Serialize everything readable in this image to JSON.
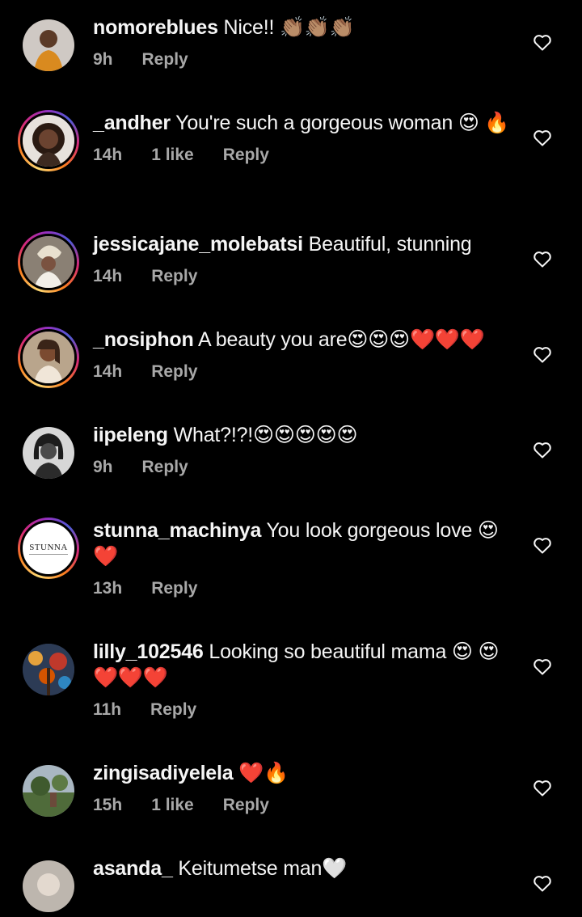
{
  "comments": [
    {
      "username": "nomoreblues",
      "text": " Nice!! 👏🏽👏🏽👏🏽",
      "time": "9h",
      "likes": "",
      "reply": "Reply",
      "avatar": "photo-avatar",
      "ring": false
    },
    {
      "username": "_andher",
      "text": " You're such a gorgeous woman 😍 🔥",
      "time": "14h",
      "likes": "1 like",
      "reply": "Reply",
      "avatar": "photo-avatar",
      "ring": true
    },
    {
      "username": "jessicajane_molebatsi",
      "text": " Beautiful, stunning",
      "time": "14h",
      "likes": "",
      "reply": "Reply",
      "avatar": "photo-avatar",
      "ring": true
    },
    {
      "username": "_nosiphon",
      "text": " A beauty you are😍😍😍❤️❤️❤️",
      "time": "14h",
      "likes": "",
      "reply": "Reply",
      "avatar": "photo-avatar",
      "ring": true
    },
    {
      "username": "iipeleng",
      "text": " What?!?!😍😍😍😍😍",
      "time": "9h",
      "likes": "",
      "reply": "Reply",
      "avatar": "photo-avatar",
      "ring": false
    },
    {
      "username": "stunna_machinya",
      "text": " You look gorgeous love 😍❤️",
      "time": "13h",
      "likes": "",
      "reply": "Reply",
      "avatar": "logo-avatar",
      "logo_text": "STUNNA",
      "ring": true
    },
    {
      "username": "lilly_102546",
      "text": " Looking so beautiful mama 😍 😍❤️❤️❤️",
      "time": "11h",
      "likes": "",
      "reply": "Reply",
      "avatar": "photo-avatar",
      "ring": false
    },
    {
      "username": "zingisadiyelela",
      "text": " ❤️🔥",
      "time": "15h",
      "likes": "1 like",
      "reply": "Reply",
      "avatar": "photo-avatar",
      "ring": false
    },
    {
      "username": "asanda_",
      "text": " Keitumetse man🤍",
      "time": "",
      "likes": "",
      "reply": "",
      "avatar": "photo-avatar",
      "ring": false
    }
  ],
  "colors": {
    "background": "#000000",
    "text": "#f5f5f5",
    "meta": "#a8a8a8"
  },
  "icons": {
    "like": "heart-outline-icon"
  }
}
